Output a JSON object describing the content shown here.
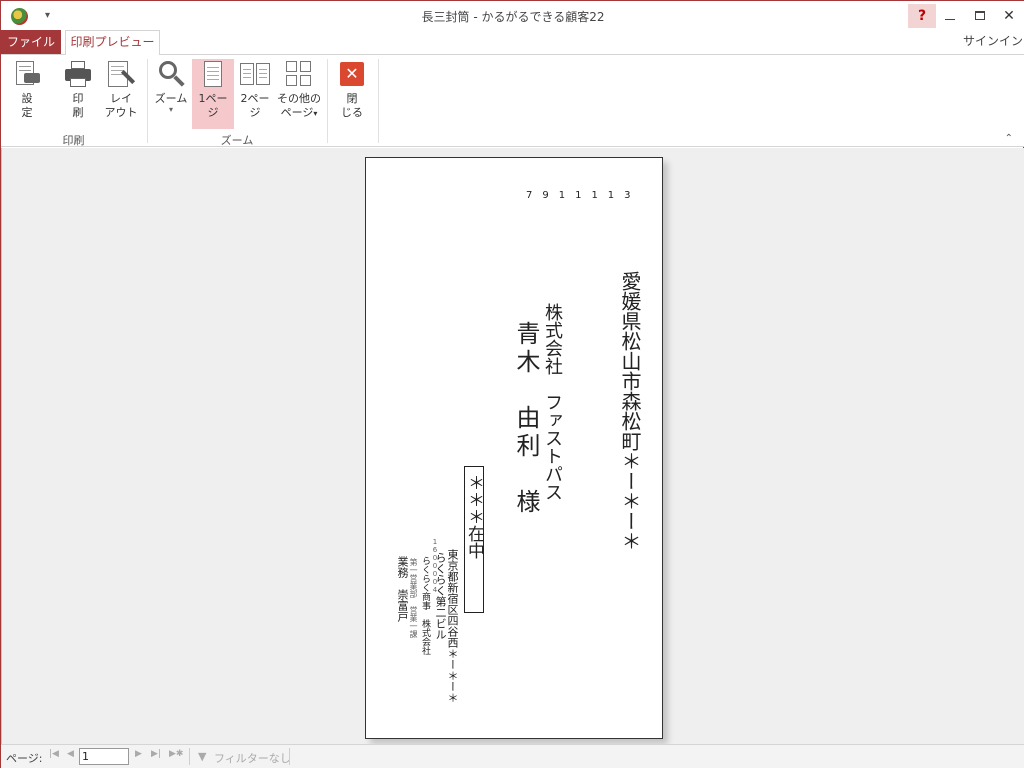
{
  "titlebar": {
    "title": "長三封筒 - かるがるできる顧客22",
    "help": "?",
    "signin": "サインイン"
  },
  "tabs": {
    "file": "ファイル",
    "print_preview": "印刷プレビュー"
  },
  "ribbon": {
    "groups": {
      "print": "印刷",
      "zoom": "ズーム"
    },
    "buttons": {
      "settings": [
        "設",
        "定"
      ],
      "print": [
        "印",
        "刷"
      ],
      "layout": [
        "レイ",
        "アウト"
      ],
      "zoom": "ズーム",
      "one_page": [
        "1ペー",
        "ジ"
      ],
      "two_pages": [
        "2ペー",
        "ジ"
      ],
      "other_pages": [
        "その他の",
        "ページ"
      ],
      "close": [
        "閉",
        "じる"
      ]
    },
    "active_button": "one_page",
    "accent_color": "#a4373a",
    "active_bg": "#f5c9cc"
  },
  "envelope": {
    "postal_code": "7911113",
    "address_line1": "愛媛県松山市森松町＊ー＊ー＊",
    "address_line2": "＊ー＊ー＊",
    "company": "株式会社　ファストパス",
    "recipient": "青木　由利　様",
    "zaichu": "＊＊＊在中",
    "sender": {
      "zip": "1600004",
      "address": "東京都新宿区四谷西＊ー＊ー＊",
      "building": "らくらく第二ビル",
      "company": "らくらく商事　株式会社",
      "department": "第一営業部　営業一課",
      "name": "業務　崇富戸"
    }
  },
  "statusbar": {
    "page_label": "ページ:",
    "page_value": "1",
    "filter": "フィルターなし"
  }
}
